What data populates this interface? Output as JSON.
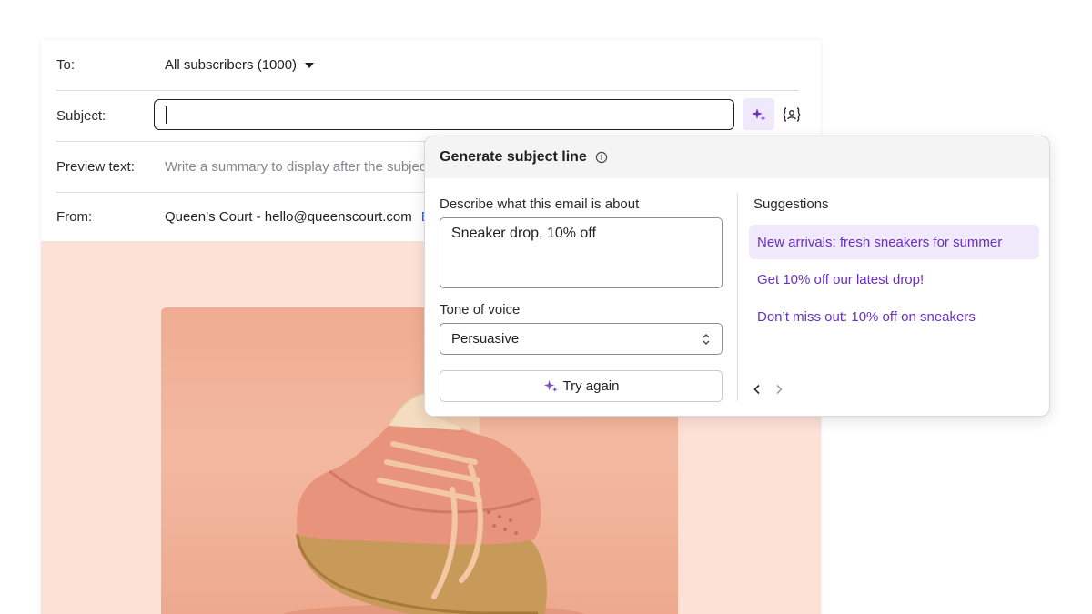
{
  "email": {
    "to": {
      "label": "To:",
      "value": "All subscribers (1000)"
    },
    "subject": {
      "label": "Subject:",
      "value": ""
    },
    "preview": {
      "label": "Preview text:",
      "placeholder": "Write a summary to display after the subject"
    },
    "from": {
      "label": "From:",
      "value": "Queen’s Court - hello@queenscourt.com",
      "edit_link": "E"
    }
  },
  "popover": {
    "title": "Generate subject line",
    "describe_label": "Describe what this email is about",
    "describe_value": "Sneaker drop, 10% off",
    "tone_label": "Tone of voice",
    "tone_value": "Persuasive",
    "try_again": "Try again",
    "suggestions_label": "Suggestions",
    "suggestions": [
      "New arrivals: fresh sneakers for summer",
      "Get 10% off our latest drop!",
      "Don’t miss out: 10% off on sneakers"
    ]
  },
  "colors": {
    "accent": "#6b2fc4",
    "accent_bg": "#efe9fb",
    "hero_bg": "#fde1d7"
  },
  "icons": {
    "ai": "sparkle-icon",
    "personalize": "personalize-icon",
    "info": "info-icon",
    "dropdown": "caret-down-icon",
    "select": "updown-icon",
    "prev": "chevron-left-icon",
    "next": "chevron-right-icon"
  }
}
